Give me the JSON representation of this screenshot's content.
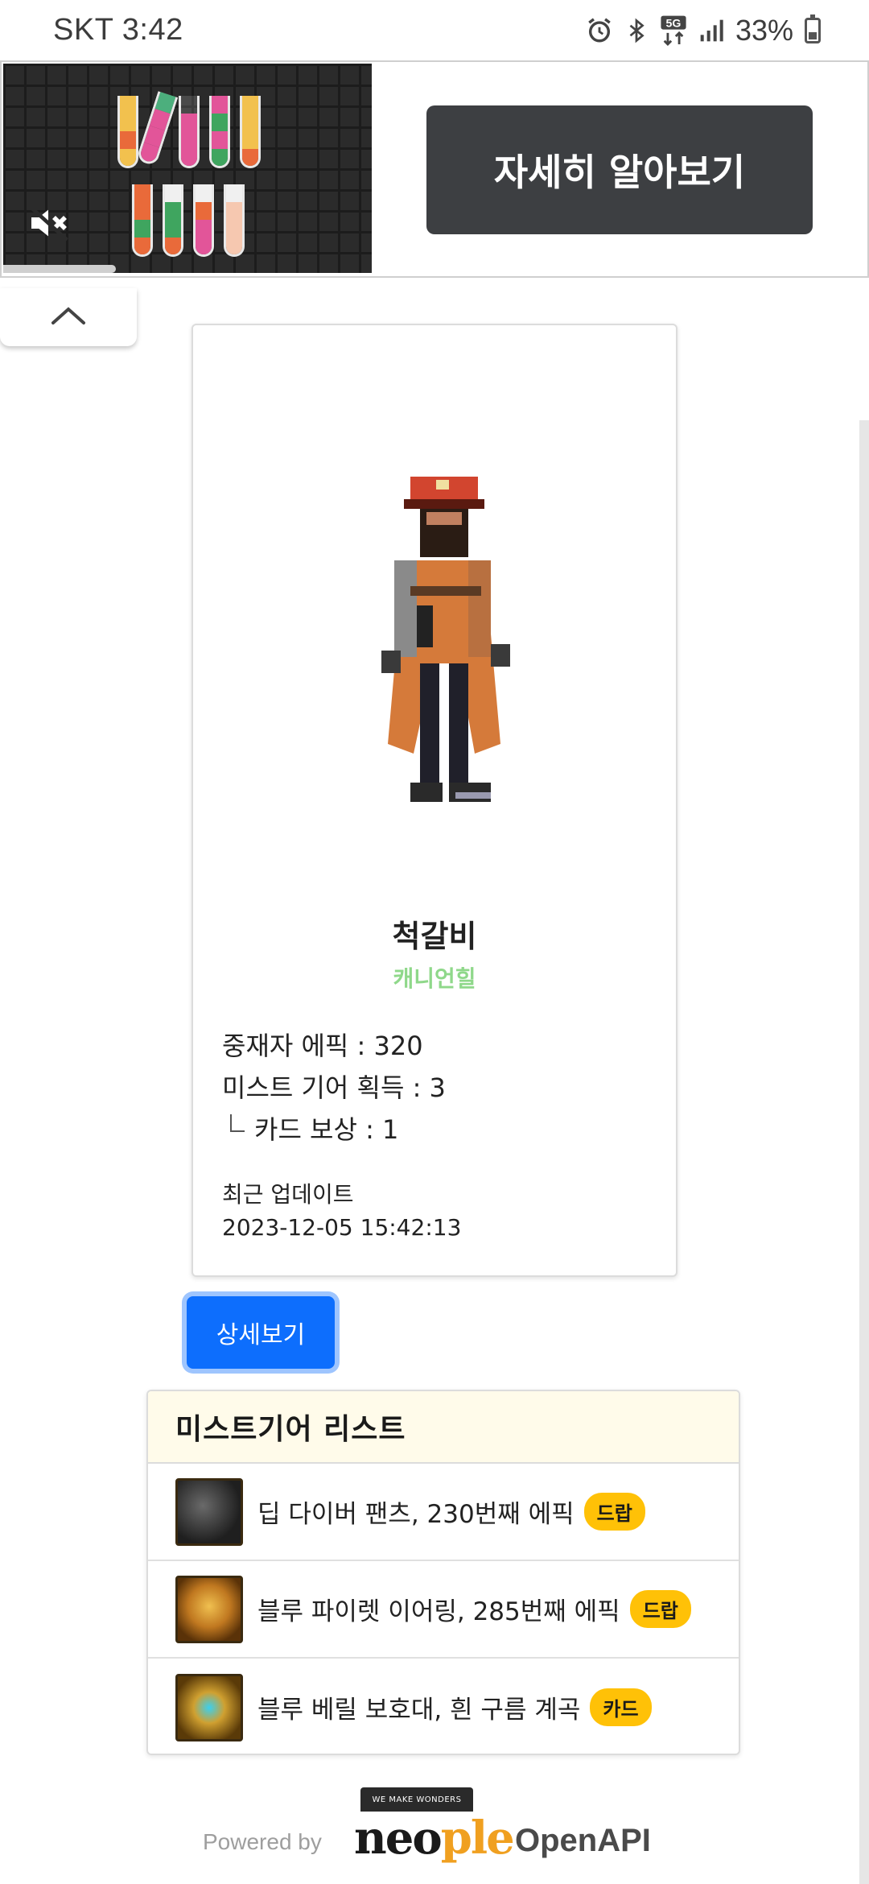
{
  "status_bar": {
    "carrier_time": "SKT 3:42",
    "network": "5G",
    "battery": "33%",
    "icons": [
      "alarm-icon",
      "bluetooth-icon",
      "5g-icon",
      "signal-icon",
      "battery-icon"
    ]
  },
  "ad": {
    "cta_label": "자세히 알아보기",
    "media_icon": "mute-icon"
  },
  "collapse": {
    "icon": "chevron-up-icon"
  },
  "character": {
    "name": "척갈비",
    "server": "캐니언힐",
    "stats": [
      "중재자 에픽 : 320",
      "미스트 기어 획득 : 3",
      "카드 보상 : 1"
    ],
    "updated_label": "최근 업데이트",
    "updated_time": "2023-12-05 15:42:13"
  },
  "detail_button": "상세보기",
  "gear_list": {
    "title": "미스트기어 리스트",
    "items": [
      {
        "name": "딥 다이버 팬츠, 230번째 에픽",
        "badge": "드랍",
        "icon": "pants-icon"
      },
      {
        "name": "블루 파이렛 이어링, 285번째 에픽",
        "badge": "드랍",
        "icon": "earring-icon"
      },
      {
        "name": "블루 베릴 보호대, 흰 구름 계곡",
        "badge": "카드",
        "icon": "bracer-icon"
      }
    ]
  },
  "footer": {
    "powered_by": "Powered by",
    "tagline": "WE MAKE WONDERS",
    "brand_a": "neo",
    "brand_b": "ple",
    "product": "OpenAPI"
  },
  "colors": {
    "primary": "#0d6efd",
    "badge": "#ffc107",
    "server": "#8fd88a",
    "ad_button": "#3d3f42"
  }
}
